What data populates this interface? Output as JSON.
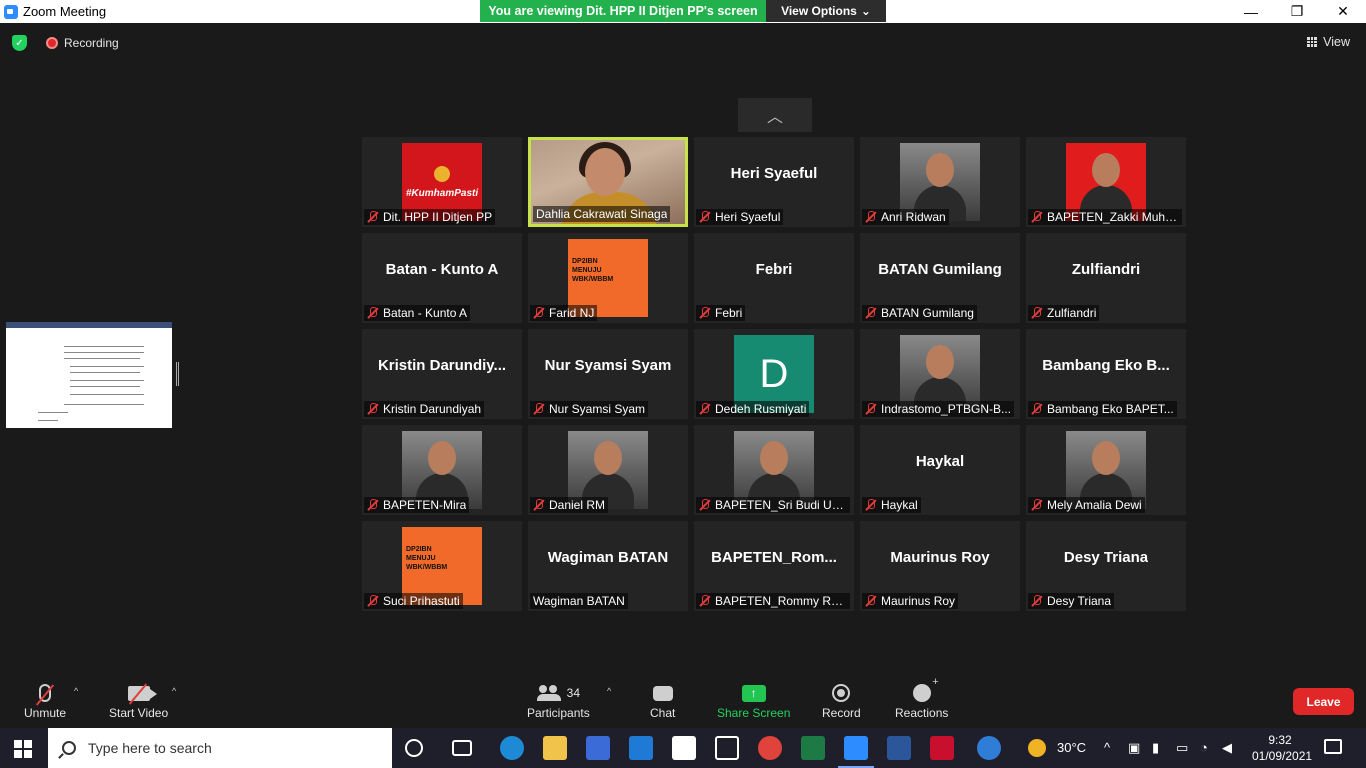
{
  "window": {
    "title": "Zoom Meeting",
    "share_banner": "You are viewing Dit. HPP II Ditjen PP's screen",
    "view_options": "View Options",
    "view_options_caret": "⌄",
    "minimize": "—",
    "maximize": "❐",
    "close": "✕"
  },
  "top": {
    "recording": "Recording",
    "view": "View"
  },
  "scroll_up_glyph": "︿",
  "tiles": [
    {
      "label": "Dit. HPP II Ditjen PP",
      "display": "",
      "type": "kumham",
      "pic_text": "#KumhamPasti",
      "muted": true,
      "active": false
    },
    {
      "label": "Dahlia Cakrawati Sinaga",
      "display": "",
      "type": "video",
      "muted": false,
      "active": true
    },
    {
      "label": "Heri Syaeful",
      "display": "Heri Syaeful",
      "type": "name",
      "muted": true,
      "active": false
    },
    {
      "label": "Anri Ridwan",
      "display": "",
      "type": "photo",
      "muted": true,
      "active": false
    },
    {
      "label": "BAPETEN_Zakki Muha...",
      "display": "",
      "type": "red",
      "muted": true,
      "active": false
    },
    {
      "label": "Batan - Kunto A",
      "display": "Batan - Kunto A",
      "type": "name",
      "muted": true,
      "active": false
    },
    {
      "label": "Farid NJ",
      "display": "",
      "type": "orange",
      "pic_text": "DP2IBN MENUJU WBK/WBBM",
      "muted": true,
      "active": false
    },
    {
      "label": "Febri",
      "display": "Febri",
      "type": "name",
      "muted": true,
      "active": false
    },
    {
      "label": "BATAN Gumilang",
      "display": "BATAN Gumilang",
      "type": "name",
      "muted": true,
      "active": false
    },
    {
      "label": "Zulfiandri",
      "display": "Zulfiandri",
      "type": "name",
      "muted": true,
      "active": false
    },
    {
      "label": "Kristin Darundiyah",
      "display": "Kristin  Darundiy...",
      "type": "name",
      "muted": true,
      "active": false
    },
    {
      "label": "Nur Syamsi Syam",
      "display": "Nur Syamsi Syam",
      "type": "name",
      "muted": true,
      "active": false
    },
    {
      "label": "Dedeh Rusmiyati",
      "display": "",
      "type": "green",
      "pic_text": "D",
      "muted": true,
      "active": false
    },
    {
      "label": "Indrastomo_PTBGN-B...",
      "display": "",
      "type": "photo",
      "muted": true,
      "active": false
    },
    {
      "label": "Bambang Eko BAPET...",
      "display": "Bambang Eko B...",
      "type": "name",
      "muted": true,
      "active": false
    },
    {
      "label": "BAPETEN-Mira",
      "display": "",
      "type": "photo",
      "muted": true,
      "active": false
    },
    {
      "label": "Daniel RM",
      "display": "",
      "type": "photo",
      "muted": true,
      "active": false
    },
    {
      "label": "BAPETEN_Sri Budi Uta...",
      "display": "",
      "type": "photo",
      "muted": true,
      "active": false
    },
    {
      "label": "Haykal",
      "display": "Haykal",
      "type": "name",
      "muted": true,
      "active": false
    },
    {
      "label": "Mely Amalia Dewi",
      "display": "",
      "type": "photo",
      "muted": true,
      "active": false
    },
    {
      "label": "Suci Prihastuti",
      "display": "",
      "type": "orange",
      "pic_text": "DP2IBN MENUJU WBK/WBBM",
      "muted": true,
      "active": false
    },
    {
      "label": "Wagiman BATAN",
      "display": "Wagiman BATAN",
      "type": "name",
      "muted": false,
      "active": false
    },
    {
      "label": "BAPETEN_Rommy Ra...",
      "display": "BAPETEN_Rom...",
      "type": "name",
      "muted": true,
      "active": false
    },
    {
      "label": "Maurinus Roy",
      "display": "Maurinus Roy",
      "type": "name",
      "muted": true,
      "active": false
    },
    {
      "label": "Desy Triana",
      "display": "Desy Triana",
      "type": "name",
      "muted": true,
      "active": false
    }
  ],
  "toolbar": {
    "unmute": "Unmute",
    "start_video": "Start Video",
    "participants": "Participants",
    "participant_count": "34",
    "chat": "Chat",
    "share_screen": "Share Screen",
    "record": "Record",
    "reactions": "Reactions",
    "leave": "Leave",
    "caret": "^",
    "share_arrow": "↑"
  },
  "taskbar": {
    "search_placeholder": "Type here to search",
    "weather": "30°C",
    "time": "9:32",
    "date": "01/09/2021"
  },
  "colors": {
    "share_green": "#22b14c",
    "leave_red": "#e02828",
    "active_border": "#c8e34a",
    "tile_bg": "#242424"
  }
}
